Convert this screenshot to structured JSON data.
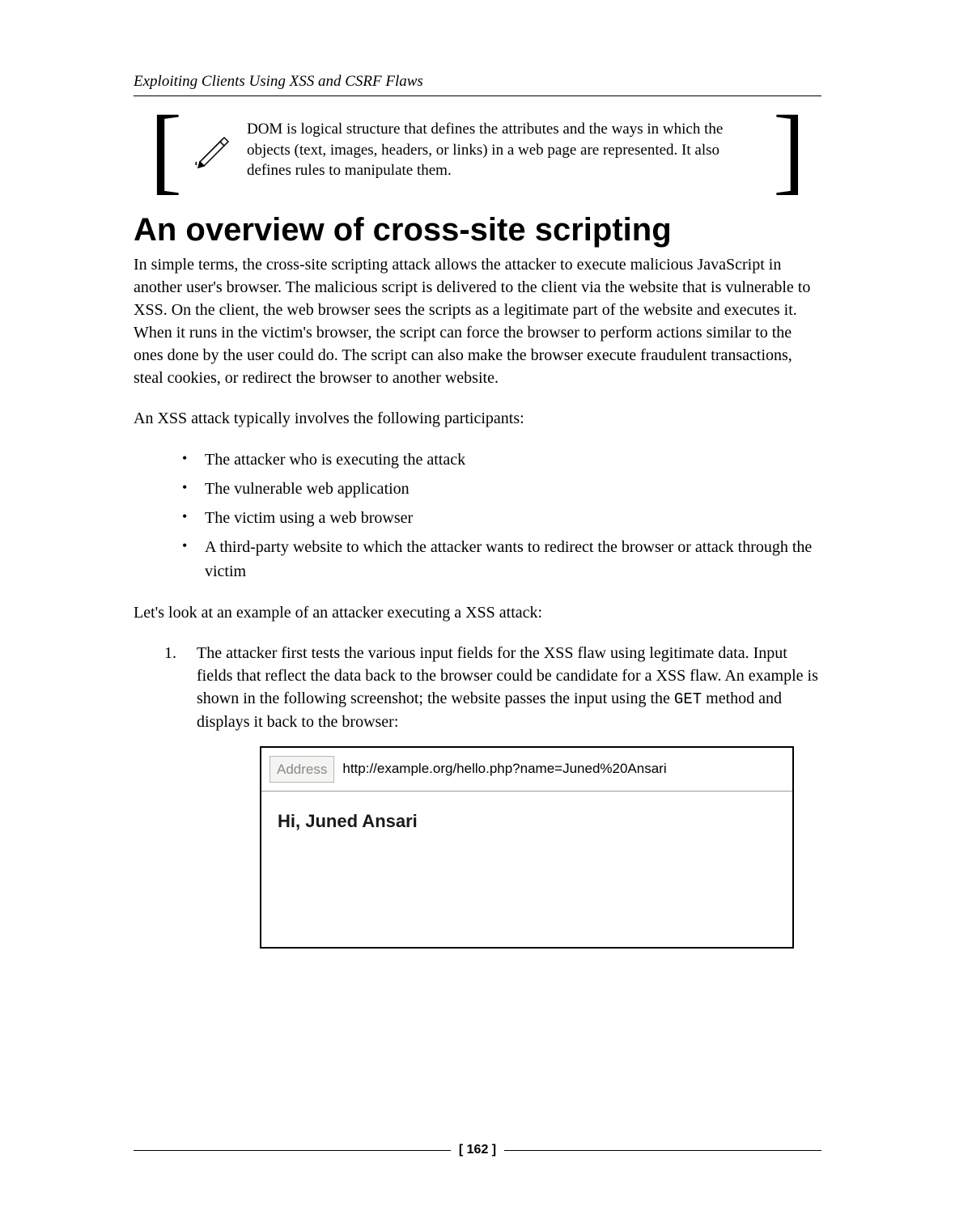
{
  "header": {
    "title": "Exploiting Clients Using XSS and CSRF Flaws"
  },
  "callout": {
    "text": "DOM is logical structure that defines the attributes and the ways in which the objects (text, images, headers, or links) in a web page are represented. It also defines rules to manipulate them."
  },
  "heading": "An overview of cross-site scripting",
  "p1": "In simple terms, the cross-site scripting attack allows the attacker to execute malicious JavaScript in another user's browser. The malicious script is delivered to the client via the website that is vulnerable to XSS. On the client, the web browser sees the scripts as a legitimate part of the website and executes it. When it runs in the victim's browser, the script can force the browser to perform actions similar to the ones done by the user could do. The script can also make the browser execute fraudulent transactions, steal cookies, or redirect the browser to another website.",
  "p2": "An XSS attack typically involves the following participants:",
  "bullets": [
    "The attacker who is executing the attack",
    "The vulnerable web application",
    "The victim using a web browser",
    "A third-party website to which the attacker wants to redirect the browser or attack through the victim"
  ],
  "p3": "Let's look at an example of an attacker executing a XSS attack:",
  "step1": {
    "num": "1.",
    "text_before": "The attacker first tests the various input fields for the XSS flaw using legitimate data. Input fields that reflect the data back to the browser could be candidate for a XSS flaw. An example is shown in the following screenshot; the website passes the input using the ",
    "code": "GET",
    "text_after": " method and displays it back to the browser:"
  },
  "browser": {
    "address_label": "Address",
    "url": "http://example.org/hello.php?name=Juned%20Ansari",
    "greeting": "Hi, Juned Ansari"
  },
  "footer": {
    "page": "[ 162 ]"
  }
}
